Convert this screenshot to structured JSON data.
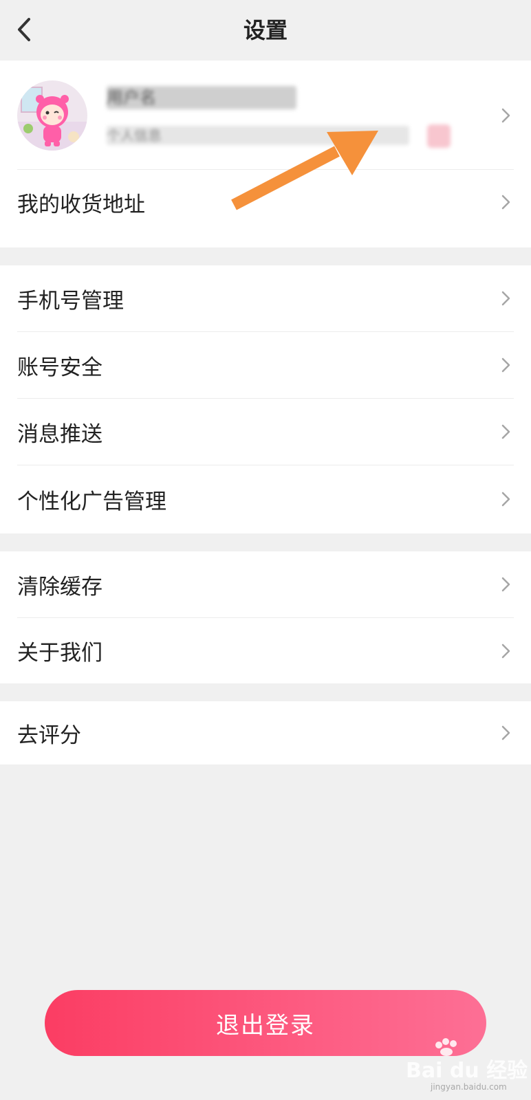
{
  "header": {
    "title": "设置",
    "back_icon": "chevron-left-icon"
  },
  "profile": {
    "name": "用户名",
    "subtitle": "个人信息",
    "avatar_icon": "cartoon-avatar-icon"
  },
  "groups": [
    {
      "items": [
        {
          "label": "我的收货地址"
        }
      ]
    },
    {
      "items": [
        {
          "label": "手机号管理"
        },
        {
          "label": "账号安全"
        },
        {
          "label": "消息推送"
        },
        {
          "label": "个性化广告管理"
        }
      ]
    },
    {
      "items": [
        {
          "label": "清除缓存"
        },
        {
          "label": "关于我们"
        }
      ]
    },
    {
      "items": [
        {
          "label": "去评分"
        }
      ]
    }
  ],
  "logout": {
    "label": "退出登录"
  },
  "annotation": {
    "arrow_icon": "orange-arrow-icon",
    "color": "#f5913b"
  },
  "watermark": {
    "text": "Bai du 经验",
    "sub": "jingyan.baidu.com"
  },
  "colors": {
    "accent": "#fb3d63",
    "background": "#f0f0f0",
    "chevron": "#a6a6a6"
  }
}
